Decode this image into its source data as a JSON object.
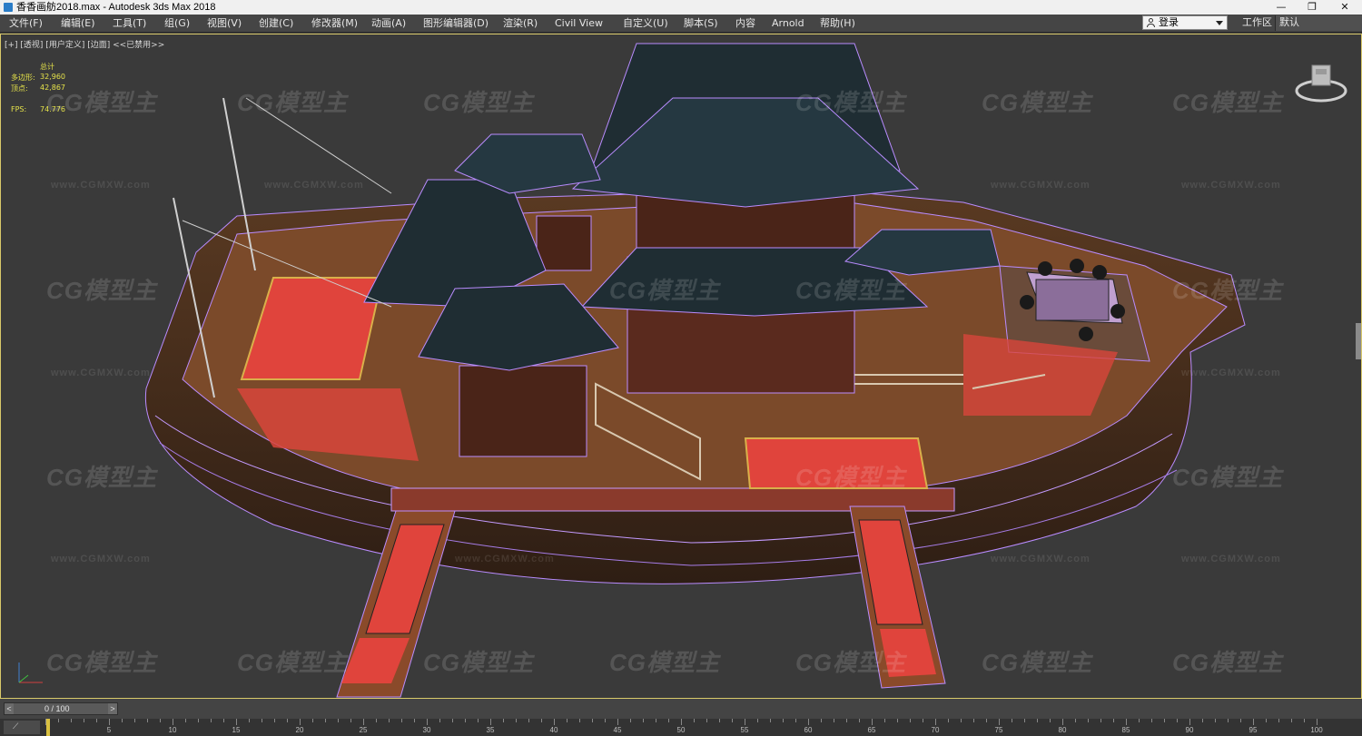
{
  "titlebar": {
    "title": "香香画舫2018.max - Autodesk 3ds Max 2018",
    "minimize": "—",
    "maximize": "❐",
    "close": "✕"
  },
  "menu": {
    "items": [
      "文件(F)",
      "编辑(E)",
      "工具(T)",
      "组(G)",
      "视图(V)",
      "创建(C)",
      "修改器(M)",
      "动画(A)",
      "图形编辑器(D)",
      "渲染(R)",
      "Civil View",
      "自定义(U)",
      "脚本(S)",
      "内容",
      "Arnold",
      "帮助(H)"
    ],
    "login_label": "登录",
    "workspace_label": "工作区",
    "workspace_value": "默认"
  },
  "viewport": {
    "label": "[+] [透视] [用户定义] [边面] <<已禁用>>",
    "stats": {
      "header": "总计",
      "polys_label": "多边形:",
      "polys_value": "32,960",
      "verts_label": "顶点:",
      "verts_value": "42,867",
      "fps_label": "FPS:",
      "fps_value": "74.776"
    },
    "watermark_big": "CG模型主",
    "watermark_small": "www.CGMXW.com"
  },
  "timeline": {
    "slider_text": "0 / 100",
    "prev": "<",
    "next": ">",
    "ticks": [
      5,
      10,
      15,
      20,
      25,
      30,
      35,
      40,
      45,
      50,
      55,
      60,
      65,
      70,
      75,
      80,
      85,
      90,
      95,
      100
    ]
  },
  "colors": {
    "wire": "#b98cff",
    "deck": "#7b4a2a",
    "carpet": "#e0443c",
    "roof": "#1f2d33",
    "hull_dark": "#3a2618"
  }
}
